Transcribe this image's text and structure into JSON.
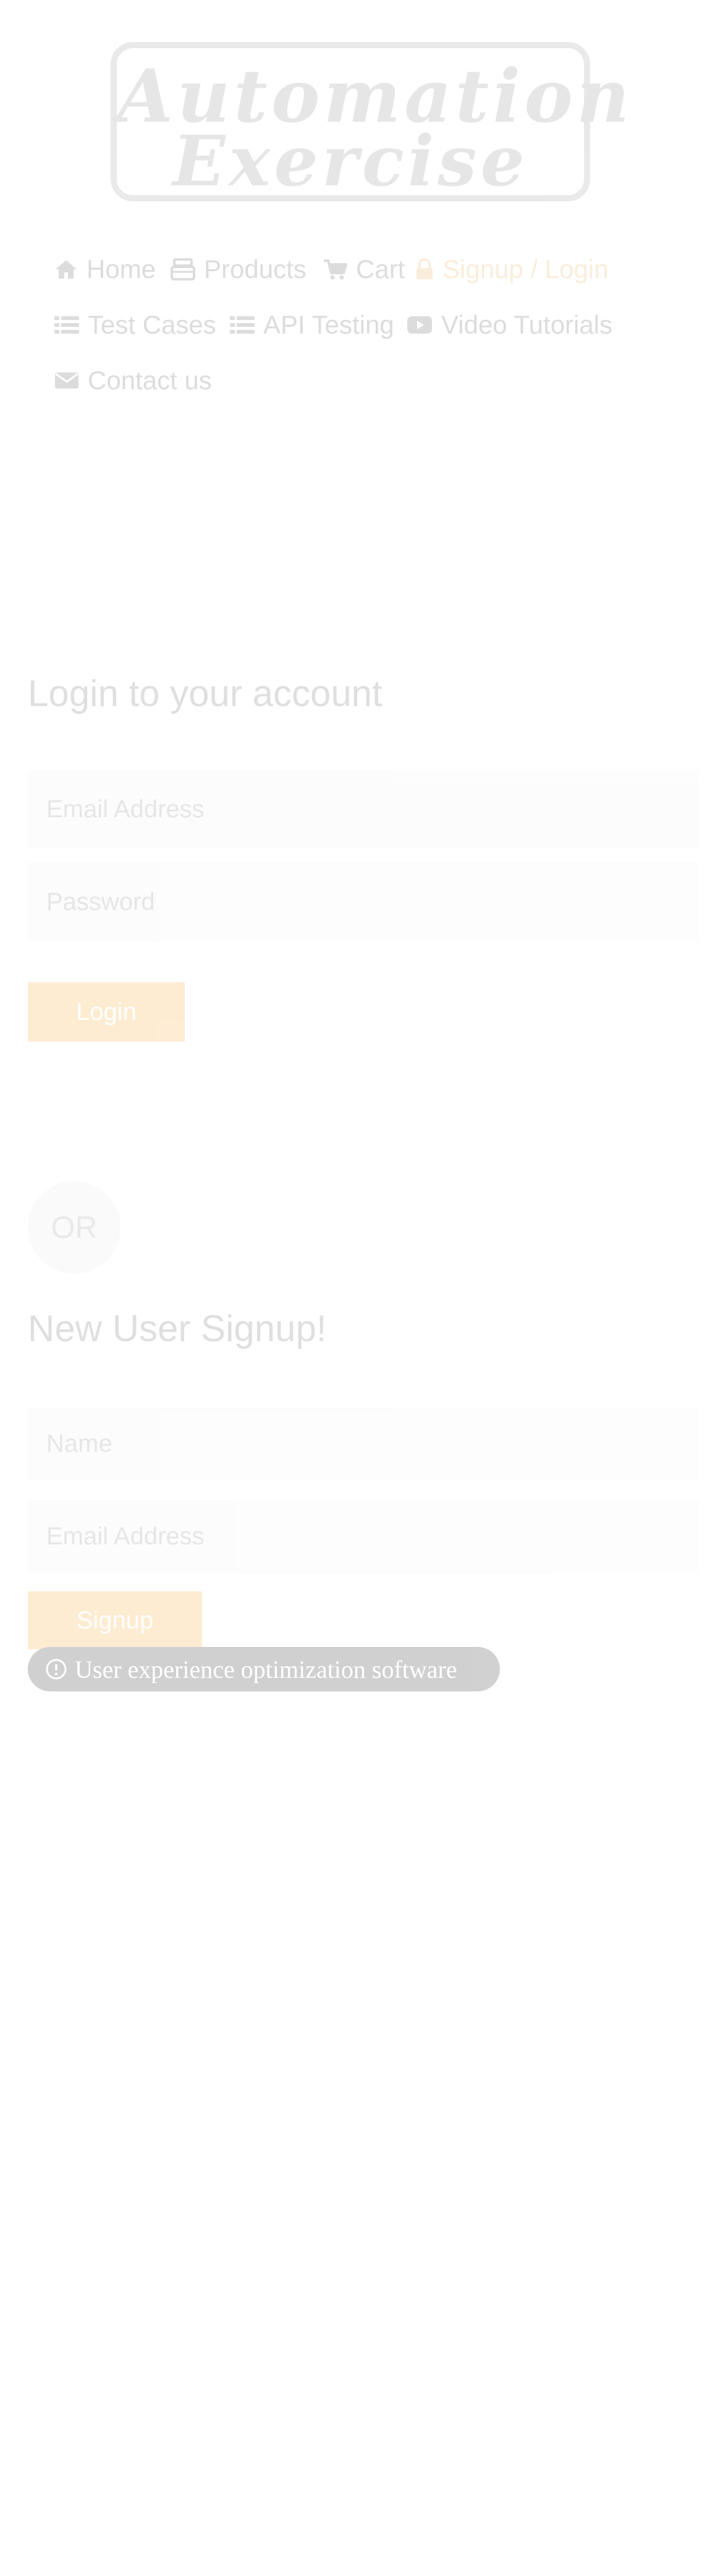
{
  "logo": {
    "line1": "Automation",
    "line2": "Exercise"
  },
  "nav": {
    "items": [
      {
        "label": "Home",
        "icon": "home-icon"
      },
      {
        "label": "Products",
        "icon": "products-icon"
      },
      {
        "label": "Cart",
        "icon": "cart-icon"
      },
      {
        "label": "Signup / Login",
        "icon": "lock-icon",
        "active": true
      },
      {
        "label": "Test Cases",
        "icon": "list-icon"
      },
      {
        "label": "API Testing",
        "icon": "list-icon"
      },
      {
        "label": "Video Tutorials",
        "icon": "youtube-icon"
      },
      {
        "label": "Contact us",
        "icon": "envelope-icon"
      }
    ]
  },
  "login": {
    "title": "Login to your account",
    "email_placeholder": "Email Address",
    "password_placeholder": "Password",
    "button": "Login"
  },
  "divider": {
    "or": "OR"
  },
  "signup": {
    "title": "New User Signup!",
    "name_placeholder": "Name",
    "email_placeholder": "Email Address",
    "button": "Signup"
  },
  "overlay_badge": {
    "text": "User experience optimization software",
    "icon": "info-icon"
  },
  "colors": {
    "accent": "#fe980f",
    "active_nav": "#e8a23c"
  }
}
